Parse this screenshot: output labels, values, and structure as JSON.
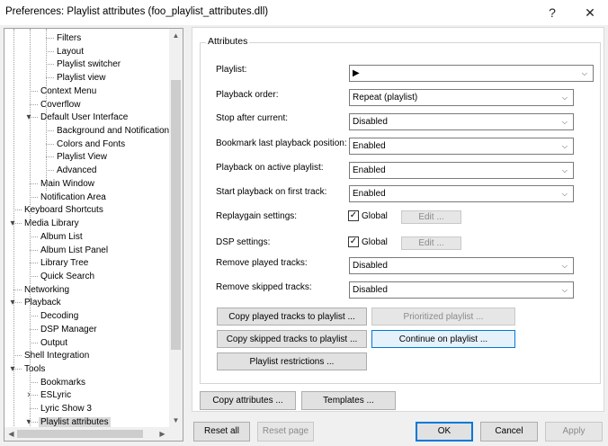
{
  "window": {
    "title": "Preferences: Playlist attributes (foo_playlist_attributes.dll)",
    "help_glyph": "?",
    "close_glyph": "✕"
  },
  "tree": {
    "items": [
      {
        "label": "Filters",
        "depth": 3,
        "expander": ""
      },
      {
        "label": "Layout",
        "depth": 3,
        "expander": ""
      },
      {
        "label": "Playlist switcher",
        "depth": 3,
        "expander": ""
      },
      {
        "label": "Playlist view",
        "depth": 3,
        "expander": ""
      },
      {
        "label": "Context Menu",
        "depth": 2,
        "expander": ""
      },
      {
        "label": "Coverflow",
        "depth": 2,
        "expander": ""
      },
      {
        "label": "Default User Interface",
        "depth": 2,
        "expander": "expanded"
      },
      {
        "label": "Background and Notifications",
        "depth": 3,
        "expander": ""
      },
      {
        "label": "Colors and Fonts",
        "depth": 3,
        "expander": ""
      },
      {
        "label": "Playlist View",
        "depth": 3,
        "expander": ""
      },
      {
        "label": "Advanced",
        "depth": 3,
        "expander": ""
      },
      {
        "label": "Main Window",
        "depth": 2,
        "expander": ""
      },
      {
        "label": "Notification Area",
        "depth": 2,
        "expander": ""
      },
      {
        "label": "Keyboard Shortcuts",
        "depth": 1,
        "expander": ""
      },
      {
        "label": "Media Library",
        "depth": 1,
        "expander": "expanded"
      },
      {
        "label": "Album List",
        "depth": 2,
        "expander": ""
      },
      {
        "label": "Album List Panel",
        "depth": 2,
        "expander": ""
      },
      {
        "label": "Library Tree",
        "depth": 2,
        "expander": ""
      },
      {
        "label": "Quick Search",
        "depth": 2,
        "expander": ""
      },
      {
        "label": "Networking",
        "depth": 1,
        "expander": ""
      },
      {
        "label": "Playback",
        "depth": 1,
        "expander": "expanded"
      },
      {
        "label": "Decoding",
        "depth": 2,
        "expander": ""
      },
      {
        "label": "DSP Manager",
        "depth": 2,
        "expander": ""
      },
      {
        "label": "Output",
        "depth": 2,
        "expander": ""
      },
      {
        "label": "Shell Integration",
        "depth": 1,
        "expander": ""
      },
      {
        "label": "Tools",
        "depth": 1,
        "expander": "expanded"
      },
      {
        "label": "Bookmarks",
        "depth": 2,
        "expander": ""
      },
      {
        "label": "ESLyric",
        "depth": 2,
        "expander": "collapsed"
      },
      {
        "label": "Lyric Show 3",
        "depth": 2,
        "expander": ""
      },
      {
        "label": "Playlist attributes",
        "depth": 2,
        "expander": "expanded",
        "selected": true
      }
    ]
  },
  "attributes": {
    "group_title": "Attributes",
    "playlist_label": "Playlist:",
    "playlist_value": "▶",
    "playback_order_label": "Playback order:",
    "playback_order_value": "Repeat (playlist)",
    "stop_after_label": "Stop after current:",
    "stop_after_value": "Disabled",
    "bookmark_label": "Bookmark last playback position:",
    "bookmark_value": "Enabled",
    "active_playlist_label": "Playback on active playlist:",
    "active_playlist_value": "Enabled",
    "start_first_label": "Start playback on first track:",
    "start_first_value": "Enabled",
    "replaygain_label": "Replaygain settings:",
    "replaygain_global": "Global",
    "replaygain_edit": "Edit ...",
    "dsp_label": "DSP settings:",
    "dsp_global": "Global",
    "dsp_edit": "Edit ...",
    "remove_played_label": "Remove played tracks:",
    "remove_played_value": "Disabled",
    "remove_skipped_label": "Remove skipped tracks:",
    "remove_skipped_value": "Disabled",
    "copy_played": "Copy played tracks to playlist ...",
    "prioritized": "Prioritized playlist ...",
    "copy_skipped": "Copy skipped tracks to playlist ...",
    "continue_on": "Continue on playlist ...",
    "restrictions": "Playlist restrictions ...",
    "copy_attributes": "Copy attributes ...",
    "templates": "Templates ..."
  },
  "footer": {
    "reset_all": "Reset all",
    "reset_page": "Reset page",
    "ok": "OK",
    "cancel": "Cancel",
    "apply": "Apply"
  },
  "checkmark": "✓",
  "dropdown_glyph": "⌵"
}
